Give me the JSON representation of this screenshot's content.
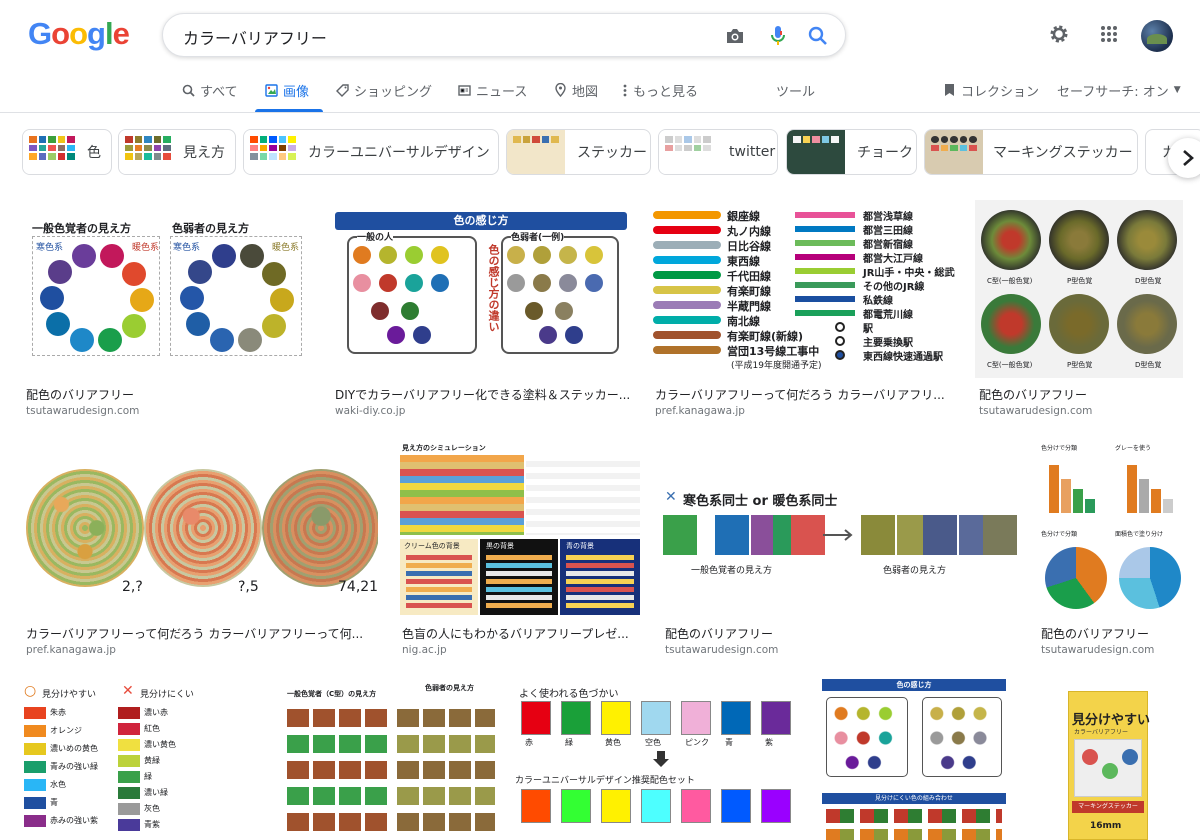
{
  "header": {
    "logo": "Google",
    "search_value": "カラーバリアフリー",
    "icons": [
      "camera-icon",
      "microphone-icon",
      "search-icon",
      "gear-icon",
      "apps-grid-icon"
    ]
  },
  "tabs": [
    {
      "label": "すべて",
      "icon": "search-icon"
    },
    {
      "label": "画像",
      "icon": "image-icon",
      "active": true
    },
    {
      "label": "ショッピング",
      "icon": "tag-icon"
    },
    {
      "label": "ニュース",
      "icon": "news-icon"
    },
    {
      "label": "地図",
      "icon": "map-pin-icon"
    },
    {
      "label": "もっと見る",
      "icon": "more-vert-icon"
    },
    {
      "label": "ツール"
    }
  ],
  "header_right": {
    "collections": "コレクション",
    "safesearch": "セーフサーチ: オン"
  },
  "chips": [
    "色",
    "見え方",
    "カラーユニバーサルデザイン",
    "ステッカー",
    "twitter",
    "チョーク",
    "マーキングステッカー",
    "カ"
  ],
  "results": {
    "row1": [
      {
        "title": "配色のバリアフリー",
        "source": "tsutawarudesign.com"
      },
      {
        "title": "DIYでカラーバリアフリー化できる塗料＆ステッカー...",
        "source": "waki-diy.co.jp"
      },
      {
        "title": "カラーバリアフリーって何だろう カラーバリアフリ...",
        "source": "pref.kanagawa.jp"
      },
      {
        "title": "配色のバリアフリー",
        "source": "tsutawarudesign.com"
      }
    ],
    "row2": [
      {
        "title": "カラーバリアフリーって何だろう カラーバリアフリーって何...",
        "source": "pref.kanagawa.jp"
      },
      {
        "title": "色盲の人にもわかるバリアフリープレゼ...",
        "source": "nig.ac.jp"
      },
      {
        "title": "配色のバリアフリー",
        "source": "tsutawarudesign.com"
      },
      {
        "title": "配色のバリアフリー",
        "source": "tsutawarudesign.com"
      }
    ]
  },
  "thumbs": {
    "t1": {
      "left_heading": "一般色覚者の見え方",
      "right_heading": "色弱者の見え方",
      "cool": "寒色系",
      "warm": "暖色系"
    },
    "t2": {
      "banner": "色の感じ方",
      "left_box": "一般の人",
      "right_box": "色弱者(一例)",
      "vertical": "色の感じ方の違い"
    },
    "t3": {
      "lines_left": [
        "銀座線",
        "丸ノ内線",
        "日比谷線",
        "東西線",
        "千代田線",
        "有楽町線",
        "半蔵門線",
        "南北線",
        "有楽町線(新線)",
        "営団13号線工事中"
      ],
      "note": "(平成19年度開通予定)",
      "lines_right": [
        "都営浅草線",
        "都営三田線",
        "都営新宿線",
        "都営大江戸線",
        "JR山手・中央・総武線",
        "その他のJR線",
        "私鉄線",
        "都電荒川線",
        "駅",
        "主要乗換駅",
        "東西線快速通過駅"
      ]
    },
    "t4": {
      "labels": [
        "C型(一般色覚)",
        "P型色覚",
        "D型色覚"
      ]
    },
    "t5": {
      "labels": [
        "2,?",
        "?,5",
        "74,21"
      ]
    },
    "t6": {
      "heading": "見え方のシミュレーション",
      "sections": [
        "クリーム色の背景",
        "黒の背景",
        "青の背景"
      ]
    },
    "t7": {
      "heading": "寒色系同士 or 暖色系同士",
      "left": "一般色覚者の見え方",
      "right": "色弱者の見え方"
    },
    "t8": {
      "labels": [
        "色分けで分類",
        "グレーを使う",
        "色分けで分類",
        "面積色で塗り分け"
      ]
    },
    "t9": {
      "good": "見分けやすい",
      "bad": "見分けにくい",
      "good_items": [
        "朱赤",
        "オレンジ",
        "濃いめの黄色",
        "青みの強い緑",
        "水色",
        "青",
        "赤みの強い紫"
      ],
      "bad_items": [
        "濃い赤",
        "紅色",
        "濃い黄色",
        "黄緑",
        "緑",
        "濃い緑",
        "灰色",
        "青紫"
      ]
    },
    "t10": {
      "left": "一般色覚者（C型）の見え方",
      "right": "色弱者の見え方"
    },
    "t11": {
      "heading": "よく使われる色づかい",
      "labels": [
        "赤",
        "緑",
        "黄色",
        "空色",
        "ピンク",
        "青",
        "紫"
      ],
      "footer": "カラーユニバーサルデザイン推奨配色セット"
    },
    "t12": {
      "banner": "色の感じ方",
      "footer": "見分けにくい色の組み合わせ"
    },
    "t13": {
      "title": "見分けやすい",
      "subtitle": "カラーバリアフリー",
      "badge": "マーキングステッカー",
      "size": "16mm"
    }
  },
  "colors": {
    "accent": "#1a73e8",
    "google_blue": "#4285f4",
    "google_red": "#ea4335",
    "google_yellow": "#fbbc05",
    "google_green": "#34a853"
  }
}
